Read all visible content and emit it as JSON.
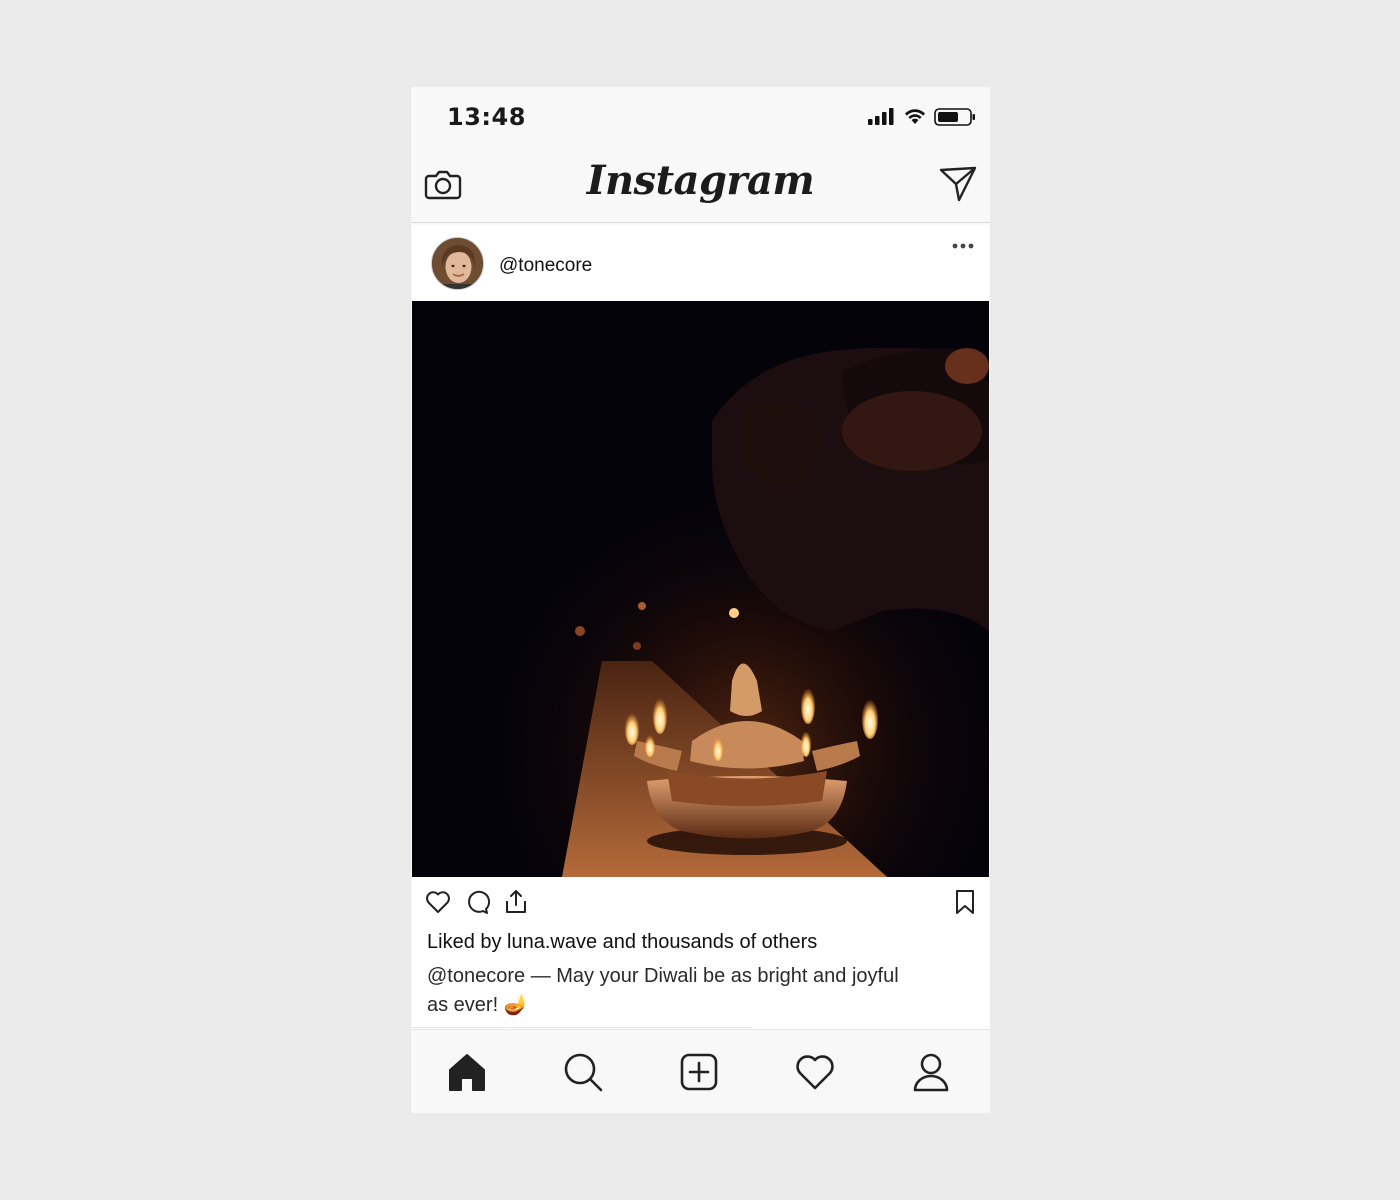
{
  "status_bar": {
    "time": "13:48",
    "icons": [
      "cellular-signal-icon",
      "wifi-icon",
      "battery-icon"
    ]
  },
  "app_header": {
    "logo": "Instagram",
    "left_icon": "camera-icon",
    "right_icon": "direct-send-icon"
  },
  "post": {
    "username": "@tonecore",
    "avatar": "avatar-photo",
    "menu_icon": "more-options-icon",
    "image": "Diwali oil lamp with lit flames in darkness",
    "actions": [
      "heart-icon",
      "comment-icon",
      "share-icon",
      "bookmark-icon"
    ],
    "likes_text": "Liked by luna.wave and thousands of others",
    "caption_line1": "@tonecore — May your Diwali be as bright and joyful",
    "caption_line2": "as ever! 🪔"
  },
  "tab_bar": {
    "items": [
      "home-icon",
      "search-icon",
      "new-post-icon",
      "activity-heart-icon",
      "profile-icon"
    ],
    "active": "home-icon"
  },
  "colors": {
    "background": "#ebebeb",
    "chrome": "#f8f8f8",
    "text": "#111111"
  }
}
